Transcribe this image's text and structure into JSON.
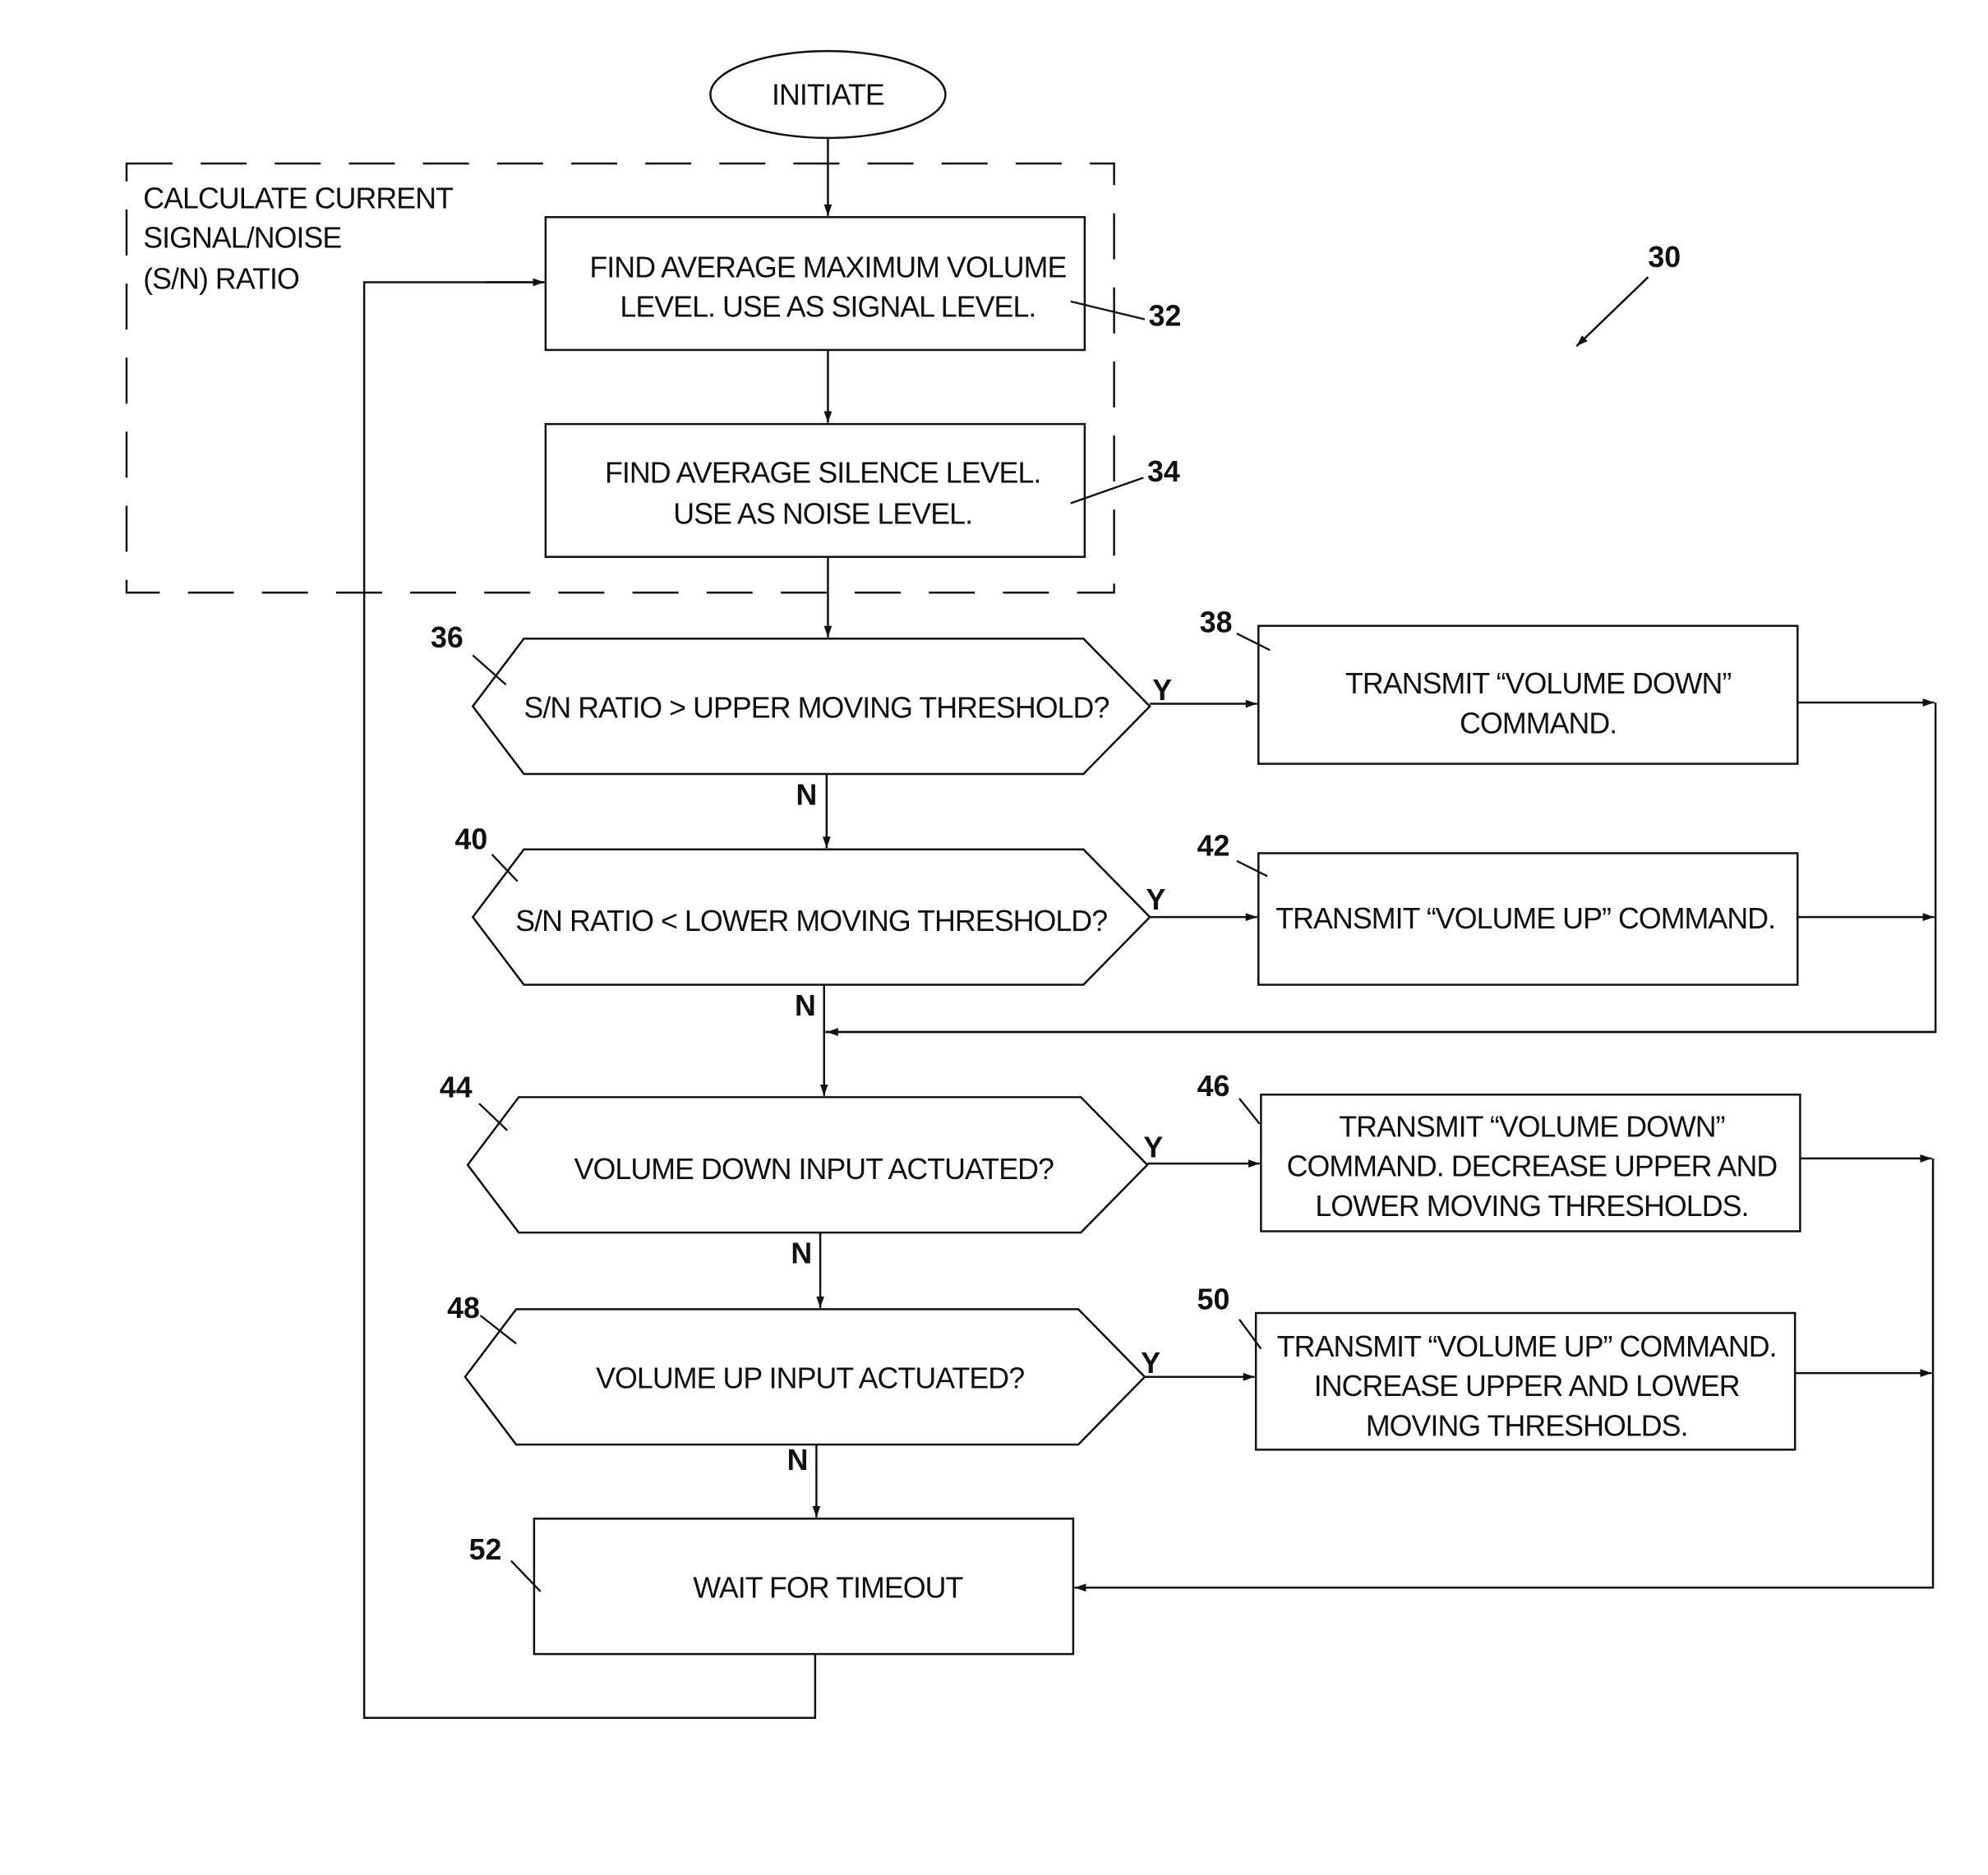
{
  "figure": {
    "reference": "30",
    "start": {
      "label": "INITIATE"
    },
    "group": {
      "label_lines": [
        "CALCULATE CURRENT",
        "SIGNAL/NOISE",
        "(S/N) RATIO"
      ]
    },
    "steps": [
      {
        "ref": "32",
        "type": "process",
        "lines": [
          "FIND AVERAGE MAXIMUM VOLUME",
          "LEVEL.  USE AS SIGNAL LEVEL."
        ]
      },
      {
        "ref": "34",
        "type": "process",
        "lines": [
          "FIND AVERAGE SILENCE LEVEL.",
          "USE AS NOISE LEVEL."
        ]
      },
      {
        "ref": "36",
        "type": "decision",
        "lines": [
          "S/N RATIO > UPPER  MOVING THRESHOLD?"
        ]
      },
      {
        "ref": "38",
        "type": "process",
        "lines": [
          "TRANSMIT “VOLUME DOWN”",
          "COMMAND."
        ]
      },
      {
        "ref": "40",
        "type": "decision",
        "lines": [
          "S/N RATIO < LOWER MOVING THRESHOLD?"
        ]
      },
      {
        "ref": "42",
        "type": "process",
        "lines": [
          "TRANSMIT “VOLUME UP” COMMAND."
        ]
      },
      {
        "ref": "44",
        "type": "decision",
        "lines": [
          "VOLUME DOWN INPUT ACTUATED?"
        ]
      },
      {
        "ref": "46",
        "type": "process",
        "lines": [
          "TRANSMIT “VOLUME DOWN”",
          "COMMAND. DECREASE UPPER AND",
          "LOWER MOVING THRESHOLDS."
        ]
      },
      {
        "ref": "48",
        "type": "decision",
        "lines": [
          "VOLUME UP INPUT ACTUATED?"
        ]
      },
      {
        "ref": "50",
        "type": "process",
        "lines": [
          "TRANSMIT “VOLUME UP” COMMAND.",
          "INCREASE UPPER AND LOWER",
          "MOVING THRESHOLDS."
        ]
      },
      {
        "ref": "52",
        "type": "process",
        "lines": [
          "WAIT FOR TIMEOUT"
        ]
      }
    ],
    "branch_labels": {
      "yes": "Y",
      "no": "N"
    }
  }
}
